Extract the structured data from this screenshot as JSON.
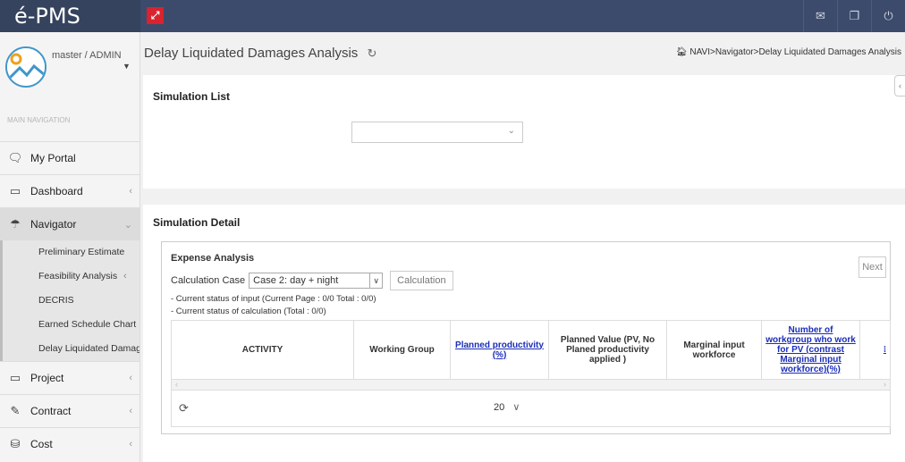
{
  "app": {
    "brand": "é-PMS"
  },
  "topbar": {
    "icons": [
      "envelope-icon",
      "copy-icon",
      "power-icon"
    ],
    "accent": "#d9232e"
  },
  "user": {
    "name": "master / ADMIN"
  },
  "nav": {
    "header": "MAIN NAVIGATION",
    "items": [
      {
        "label": "My Portal",
        "icon": "monitor-icon"
      },
      {
        "label": "Dashboard",
        "icon": "desktop-icon"
      },
      {
        "label": "Navigator",
        "icon": "umbrella-icon"
      },
      {
        "label": "Project",
        "icon": "desktop-icon"
      },
      {
        "label": "Contract",
        "icon": "pencil-icon"
      },
      {
        "label": "Cost",
        "icon": "database-icon"
      }
    ],
    "navigator_sub": [
      "Preliminary Estimate",
      "Feasibility Analysis",
      "DECRIS",
      "Earned Schedule Chart",
      "Delay Liquidated Damages Analysis"
    ]
  },
  "page": {
    "title": "Delay Liquidated Damages Analysis",
    "breadcrumb": "NAVI>Navigator>Delay Liquidated Damages Analysis"
  },
  "simulation_list": {
    "title": "Simulation List",
    "selected": ""
  },
  "simulation_detail": {
    "title": "Simulation Detail",
    "expense": {
      "title": "Expense Analysis",
      "next_label": "Next",
      "calc_case_label": "Calculation Case",
      "calc_case_value": "Case 2: day + night",
      "calc_button": "Calculation",
      "status_input": "- Current status of input (Current Page : 0/0 Total : 0/0)",
      "status_calc": "- Current status of calculation (Total : 0/0)",
      "columns": [
        "ACTIVITY",
        "Working Group",
        "Planned productivity (%)",
        "Planned Value (PV, No Planed productivity applied )",
        "Marginal input workforce",
        "Number of workgroup who work for PV (contrast Marginal input workforce)(%)"
      ],
      "page_size": "20"
    }
  }
}
